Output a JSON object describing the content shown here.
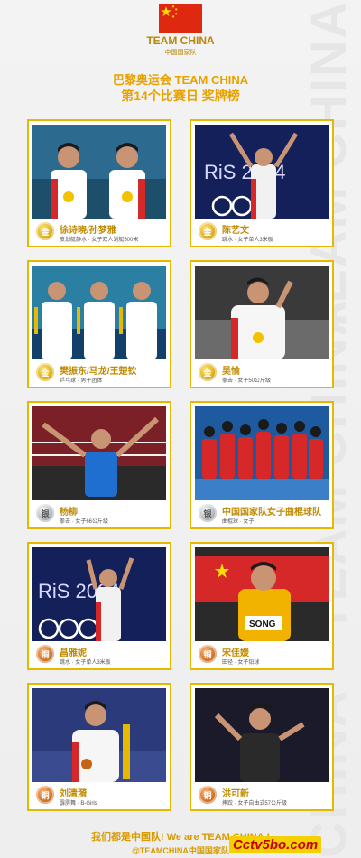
{
  "header": {
    "brand": "TEAM CHINA",
    "brand_cn": "中国国家队",
    "title_line1": "巴黎奥运会 TEAM CHINA",
    "title_line2": "第14个比赛日 奖牌榜"
  },
  "watermark_text": "TEAM CHINA",
  "medals": [
    {
      "medal": "金",
      "type": "gold",
      "name": "徐诗晓/孙梦雅",
      "event": "皮划艇静水 · 女子双人划艇500米"
    },
    {
      "medal": "金",
      "type": "gold",
      "name": "陈艺文",
      "event": "跳水 · 女子单人3米板"
    },
    {
      "medal": "金",
      "type": "gold",
      "name": "樊振东/马龙/王楚钦",
      "event": "乒乓球 · 男子团体"
    },
    {
      "medal": "金",
      "type": "gold",
      "name": "吴愉",
      "event": "拳击 · 女子50公斤级"
    },
    {
      "medal": "银",
      "type": "silver",
      "name": "杨柳",
      "event": "拳击 · 女子66公斤级"
    },
    {
      "medal": "银",
      "type": "silver",
      "name": "中国国家队女子曲棍球队",
      "event": "曲棍球 · 女子"
    },
    {
      "medal": "铜",
      "type": "bronze",
      "name": "昌雅妮",
      "event": "跳水 · 女子单人3米板"
    },
    {
      "medal": "铜",
      "type": "bronze",
      "name": "宋佳媛",
      "event": "田径 · 女子铅球"
    },
    {
      "medal": "铜",
      "type": "bronze",
      "name": "刘清漪",
      "event": "霹雳舞 · B-Girls"
    },
    {
      "medal": "铜",
      "type": "bronze",
      "name": "洪可新",
      "event": "摔跤 · 女子自由式57公斤级"
    }
  ],
  "photo_texts": {
    "paris_logo": "RiS 2024",
    "bib": "SONG"
  },
  "footer": {
    "line1": "我们都是中国队! We are TEAM CHINA !",
    "line2": "@TEAMCHINA中国国家队",
    "corner_watermark": "Cctv5bo.com"
  },
  "colors": {
    "gold_text": "#c08a00",
    "title": "#e8a200",
    "card_border": "#e6b800",
    "flag_red": "#de2910"
  }
}
